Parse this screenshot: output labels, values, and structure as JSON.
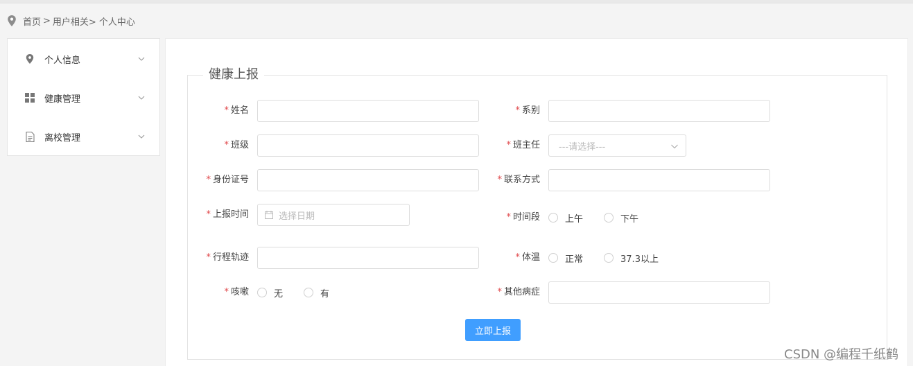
{
  "breadcrumb": {
    "home": "首页",
    "sep1": ">",
    "section": "用户相关>",
    "current": "个人中心"
  },
  "sidebar": {
    "items": [
      {
        "label": "个人信息",
        "icon": "location-pin-icon"
      },
      {
        "label": "健康管理",
        "icon": "grid-icon"
      },
      {
        "label": "离校管理",
        "icon": "document-icon"
      }
    ]
  },
  "form": {
    "title": "健康上报",
    "required_mark": "*",
    "fields": {
      "name": {
        "label": "姓名",
        "value": ""
      },
      "department": {
        "label": "系别",
        "value": ""
      },
      "class": {
        "label": "班级",
        "value": ""
      },
      "head_teacher": {
        "label": "班主任",
        "placeholder": "---请选择---"
      },
      "id_number": {
        "label": "身份证号",
        "value": ""
      },
      "contact": {
        "label": "联系方式",
        "value": ""
      },
      "report_time": {
        "label": "上报时间",
        "placeholder": "选择日期"
      },
      "time_period": {
        "label": "时间段",
        "options": [
          "上午",
          "下午"
        ]
      },
      "itinerary": {
        "label": "行程轨迹",
        "value": ""
      },
      "temperature": {
        "label": "体温",
        "options": [
          "正常",
          "37.3以上"
        ]
      },
      "cough": {
        "label": "咳嗽",
        "options": [
          "无",
          "有"
        ]
      },
      "other_symptoms": {
        "label": "其他病症",
        "value": ""
      }
    },
    "submit_label": "立即上报"
  },
  "watermark": "CSDN @编程千纸鹤",
  "colors": {
    "primary": "#409eff",
    "required": "#e0474a",
    "background": "#f4f4f4"
  }
}
